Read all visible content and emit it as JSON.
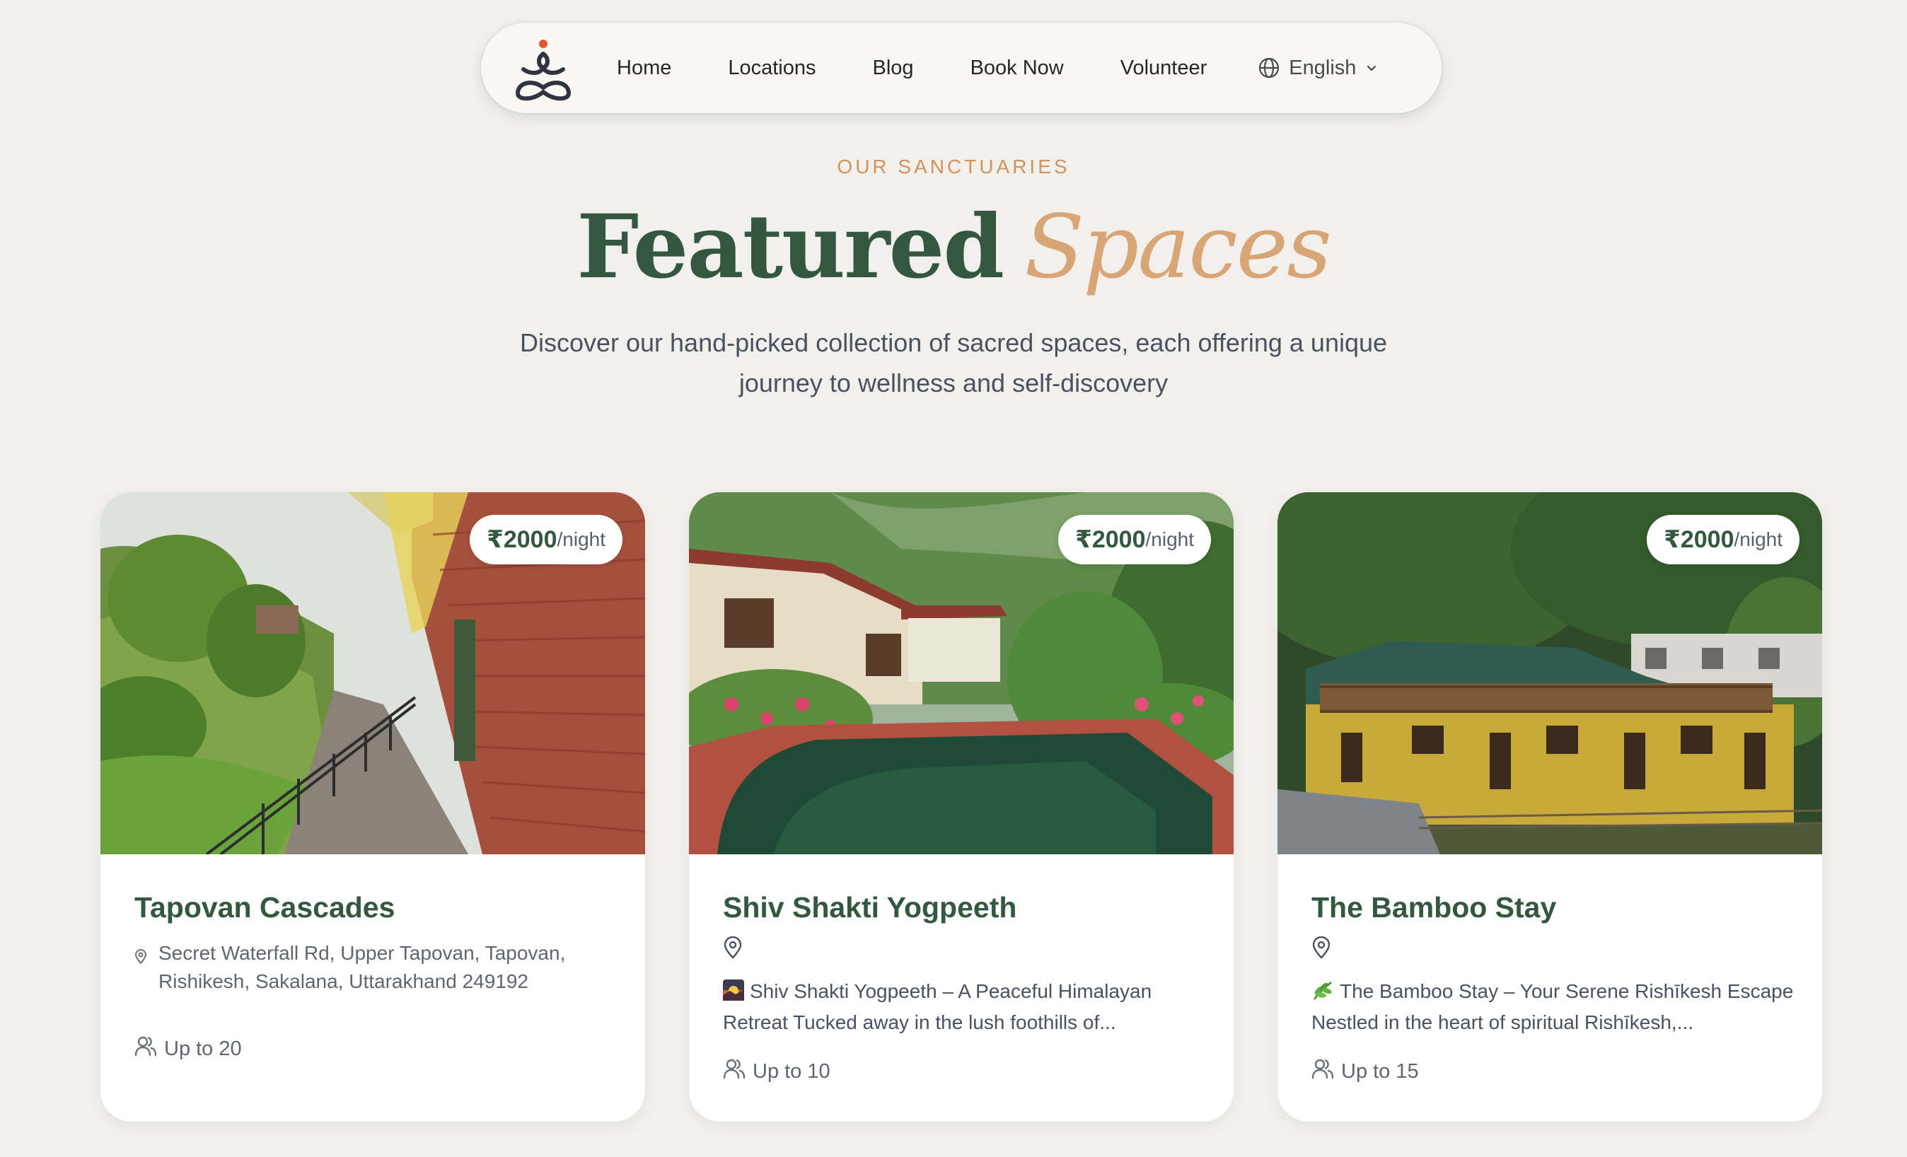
{
  "nav": {
    "logo_icon": "meditation-figure-icon",
    "links": [
      "Home",
      "Locations",
      "Blog",
      "Book Now",
      "Volunteer"
    ],
    "language": "English"
  },
  "header": {
    "eyebrow": "OUR SANCTUARIES",
    "title_main": "Featured",
    "title_accent": "Spaces",
    "subtitle": "Discover our hand-picked collection of sacred spaces, each offering a unique journey to wellness and self-discovery"
  },
  "colors": {
    "brand_green": "#33573f",
    "accent_tan": "#d8a577",
    "eyebrow_orange": "#d3925a",
    "background": "#f1f0ec"
  },
  "cards": [
    {
      "title": "Tapovan Cascades",
      "price": "₹2000",
      "price_unit": "/night",
      "address": "Secret Waterfall Rd, Upper Tapovan, Tapovan, Rishikesh, Sakalana, Uttarakhand 249192",
      "description": "",
      "capacity": "Up to 20"
    },
    {
      "title": "Shiv Shakti Yogpeeth",
      "price": "₹2000",
      "price_unit": "/night",
      "address": "",
      "description_icon": "sunrise-emoji",
      "description": "Shiv Shakti Yogpeeth – A Peaceful Himalayan Retreat Tucked away in the lush foothills of...",
      "capacity": "Up to 10"
    },
    {
      "title": "The Bamboo Stay",
      "price": "₹2000",
      "price_unit": "/night",
      "address": "",
      "description_icon": "herb-emoji",
      "description": "The Bamboo Stay – Your Serene Rishīkesh Escape Nestled in the heart of spiritual Rishīkesh,...",
      "capacity": "Up to 15"
    }
  ]
}
